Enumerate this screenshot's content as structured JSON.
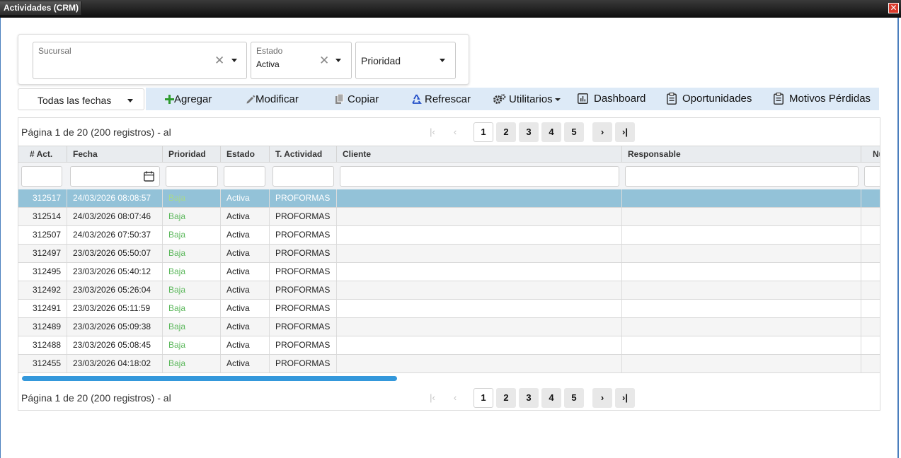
{
  "window": {
    "title": "Actividades (CRM)",
    "close_glyph": "✕"
  },
  "filters": {
    "sucursal": {
      "label": "Sucursal",
      "value": ""
    },
    "estado": {
      "label": "Estado",
      "value": "Activa"
    },
    "prioridad": {
      "placeholder": "Prioridad"
    }
  },
  "date_filter": {
    "value": "Todas las fechas"
  },
  "toolbar": {
    "agregar": "Agregar",
    "modificar": "Modificar",
    "copiar": "Copiar",
    "refrescar": "Refrescar",
    "utilitarios": "Utilitarios",
    "dashboard": "Dashboard",
    "oportunidades": "Oportunidades",
    "motivos": "Motivos Pérdidas"
  },
  "pagination": {
    "info": "Página 1 de 20 (200 registros) - al",
    "pages": [
      "1",
      "2",
      "3",
      "4",
      "5"
    ],
    "current": "1"
  },
  "table": {
    "headers": {
      "id": "# Act.",
      "fecha": "Fecha",
      "prioridad": "Prioridad",
      "estado": "Estado",
      "tipo": "T. Actividad",
      "cliente": "Cliente",
      "responsable": "Responsable",
      "extra": "Nu"
    },
    "rows": [
      {
        "id": "312517",
        "fecha": "24/03/2026 08:08:57",
        "prioridad": "Baja",
        "estado": "Activa",
        "tipo": "PROFORMAS",
        "cliente": "",
        "responsable": ""
      },
      {
        "id": "312514",
        "fecha": "24/03/2026 08:07:46",
        "prioridad": "Baja",
        "estado": "Activa",
        "tipo": "PROFORMAS",
        "cliente": "",
        "responsable": ""
      },
      {
        "id": "312507",
        "fecha": "24/03/2026 07:50:37",
        "prioridad": "Baja",
        "estado": "Activa",
        "tipo": "PROFORMAS",
        "cliente": "",
        "responsable": ""
      },
      {
        "id": "312497",
        "fecha": "23/03/2026 05:50:07",
        "prioridad": "Baja",
        "estado": "Activa",
        "tipo": "PROFORMAS",
        "cliente": "",
        "responsable": ""
      },
      {
        "id": "312495",
        "fecha": "23/03/2026 05:40:12",
        "prioridad": "Baja",
        "estado": "Activa",
        "tipo": "PROFORMAS",
        "cliente": "",
        "responsable": ""
      },
      {
        "id": "312492",
        "fecha": "23/03/2026 05:26:04",
        "prioridad": "Baja",
        "estado": "Activa",
        "tipo": "PROFORMAS",
        "cliente": "",
        "responsable": ""
      },
      {
        "id": "312491",
        "fecha": "23/03/2026 05:11:59",
        "prioridad": "Baja",
        "estado": "Activa",
        "tipo": "PROFORMAS",
        "cliente": "",
        "responsable": ""
      },
      {
        "id": "312489",
        "fecha": "23/03/2026 05:09:38",
        "prioridad": "Baja",
        "estado": "Activa",
        "tipo": "PROFORMAS",
        "cliente": "",
        "responsable": ""
      },
      {
        "id": "312488",
        "fecha": "23/03/2026 05:08:45",
        "prioridad": "Baja",
        "estado": "Activa",
        "tipo": "PROFORMAS",
        "cliente": "",
        "responsable": ""
      },
      {
        "id": "312455",
        "fecha": "23/03/2026 04:18:02",
        "prioridad": "Baja",
        "estado": "Activa",
        "tipo": "PROFORMAS",
        "cliente": "",
        "responsable": ""
      }
    ],
    "selected_row": 0
  },
  "colors": {
    "toolbar_bg": "#ddeaf7",
    "selected_row": "#93c2d8",
    "priority_low": "#5cb85c",
    "window_border": "#4a7ebd",
    "scrollbar": "#3498db"
  }
}
